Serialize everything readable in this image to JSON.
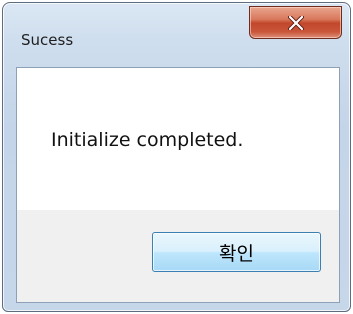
{
  "dialog": {
    "title": "Sucess",
    "message": "Initialize completed.",
    "ok_label": "확인",
    "close_icon": "close-x-icon"
  },
  "colors": {
    "frame": "#c7d7ea",
    "close_button": "#c7482c",
    "ok_button_border": "#3c7fb1",
    "footer": "#f0f0f0"
  }
}
